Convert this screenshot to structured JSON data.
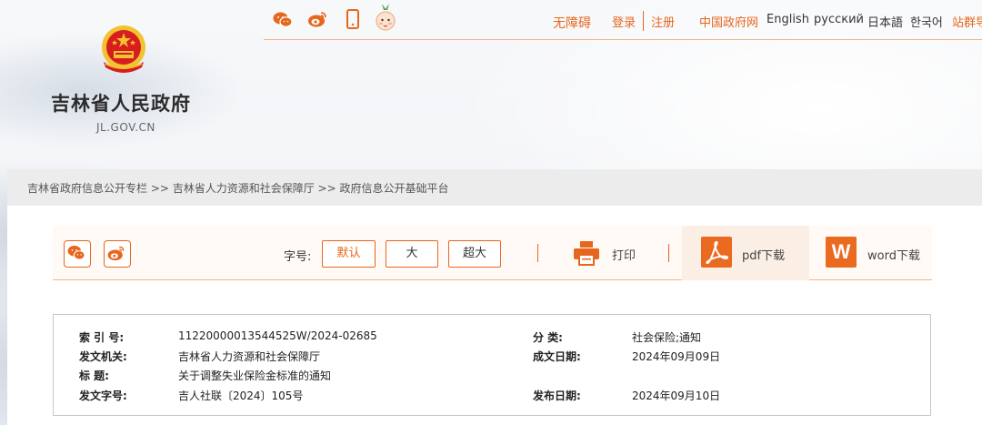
{
  "header": {
    "site_name": "吉林省人民政府",
    "site_domain": "JL.GOV.CN",
    "social_icons": [
      "wechat-icon",
      "weibo-icon",
      "mobile-icon",
      "mascot-icon"
    ],
    "nav": {
      "accessibility": "无障碍",
      "login": "登录",
      "register": "注册",
      "china_gov": "中国政府网",
      "english": "English",
      "russian": "русский",
      "japanese": "日本語",
      "korean": "한국어",
      "sitegroup": "站群导"
    }
  },
  "breadcrumb": "吉林省政府信息公开专栏 >> 吉林省人力资源和社会保障厅 >> 政府信息公开基础平台",
  "toolbar": {
    "font_size_label": "字号:",
    "font_default": "默认",
    "font_large": "大",
    "font_xlarge": "超大",
    "print_label": "打印",
    "pdf_label": "pdf下载",
    "word_label": "word下载",
    "word_icon_letter": "W"
  },
  "meta": {
    "index_key": "索  引  号:",
    "index_val": "11220000013544525W/2024-02685",
    "category_key": "分      类:",
    "category_val": "社会保险;通知",
    "issuer_key": "发文机关:",
    "issuer_val": "吉林省人力资源和社会保障厅",
    "written_date_key": "成文日期:",
    "written_date_val": "2024年09月09日",
    "title_key": "标      题:",
    "title_val": "关于调整失业保险金标准的通知",
    "doc_no_key": "发文字号:",
    "doc_no_val": "吉人社联〔2024〕105号",
    "publish_date_key": "发布日期:",
    "publish_date_val": "2024年09月10日"
  },
  "colors": {
    "accent": "#e7661d",
    "emblem_red": "#d71e1e",
    "emblem_gold": "#f2c230"
  }
}
